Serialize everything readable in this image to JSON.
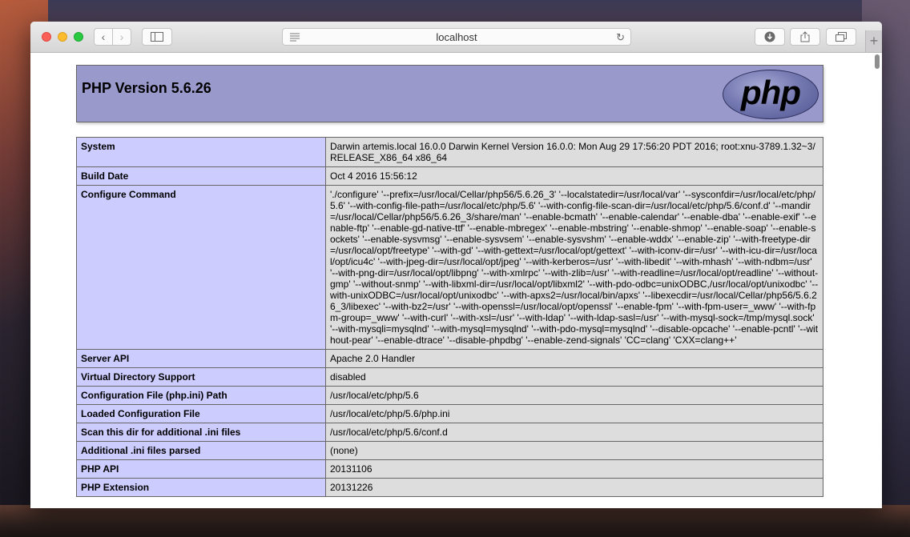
{
  "browser": {
    "url": "localhost"
  },
  "phpinfo": {
    "title": "PHP Version 5.6.26",
    "logo_text": "php",
    "rows": [
      {
        "key": "System",
        "value": "Darwin artemis.local 16.0.0 Darwin Kernel Version 16.0.0: Mon Aug 29 17:56:20 PDT 2016; root:xnu-3789.1.32~3/RELEASE_X86_64 x86_64"
      },
      {
        "key": "Build Date",
        "value": "Oct 4 2016 15:56:12"
      },
      {
        "key": "Configure Command",
        "value": "'./configure' '--prefix=/usr/local/Cellar/php56/5.6.26_3' '--localstatedir=/usr/local/var' '--sysconfdir=/usr/local/etc/php/5.6' '--with-config-file-path=/usr/local/etc/php/5.6' '--with-config-file-scan-dir=/usr/local/etc/php/5.6/conf.d' '--mandir=/usr/local/Cellar/php56/5.6.26_3/share/man' '--enable-bcmath' '--enable-calendar' '--enable-dba' '--enable-exif' '--enable-ftp' '--enable-gd-native-ttf' '--enable-mbregex' '--enable-mbstring' '--enable-shmop' '--enable-soap' '--enable-sockets' '--enable-sysvmsg' '--enable-sysvsem' '--enable-sysvshm' '--enable-wddx' '--enable-zip' '--with-freetype-dir=/usr/local/opt/freetype' '--with-gd' '--with-gettext=/usr/local/opt/gettext' '--with-iconv-dir=/usr' '--with-icu-dir=/usr/local/opt/icu4c' '--with-jpeg-dir=/usr/local/opt/jpeg' '--with-kerberos=/usr' '--with-libedit' '--with-mhash' '--with-ndbm=/usr' '--with-png-dir=/usr/local/opt/libpng' '--with-xmlrpc' '--with-zlib=/usr' '--with-readline=/usr/local/opt/readline' '--without-gmp' '--without-snmp' '--with-libxml-dir=/usr/local/opt/libxml2' '--with-pdo-odbc=unixODBC,/usr/local/opt/unixodbc' '--with-unixODBC=/usr/local/opt/unixodbc' '--with-apxs2=/usr/local/bin/apxs' '--libexecdir=/usr/local/Cellar/php56/5.6.26_3/libexec' '--with-bz2=/usr' '--with-openssl=/usr/local/opt/openssl' '--enable-fpm' '--with-fpm-user=_www' '--with-fpm-group=_www' '--with-curl' '--with-xsl=/usr' '--with-ldap' '--with-ldap-sasl=/usr' '--with-mysql-sock=/tmp/mysql.sock' '--with-mysqli=mysqlnd' '--with-mysql=mysqlnd' '--with-pdo-mysql=mysqlnd' '--disable-opcache' '--enable-pcntl' '--without-pear' '--enable-dtrace' '--disable-phpdbg' '--enable-zend-signals' 'CC=clang' 'CXX=clang++'"
      },
      {
        "key": "Server API",
        "value": "Apache 2.0 Handler"
      },
      {
        "key": "Virtual Directory Support",
        "value": "disabled"
      },
      {
        "key": "Configuration File (php.ini) Path",
        "value": "/usr/local/etc/php/5.6"
      },
      {
        "key": "Loaded Configuration File",
        "value": "/usr/local/etc/php/5.6/php.ini"
      },
      {
        "key": "Scan this dir for additional .ini files",
        "value": "/usr/local/etc/php/5.6/conf.d"
      },
      {
        "key": "Additional .ini files parsed",
        "value": "(none)"
      },
      {
        "key": "PHP API",
        "value": "20131106"
      },
      {
        "key": "PHP Extension",
        "value": "20131226"
      }
    ]
  },
  "colors": {
    "header_bg": "#9999cc",
    "key_cell_bg": "#ccccff",
    "value_cell_bg": "#dddddd"
  }
}
